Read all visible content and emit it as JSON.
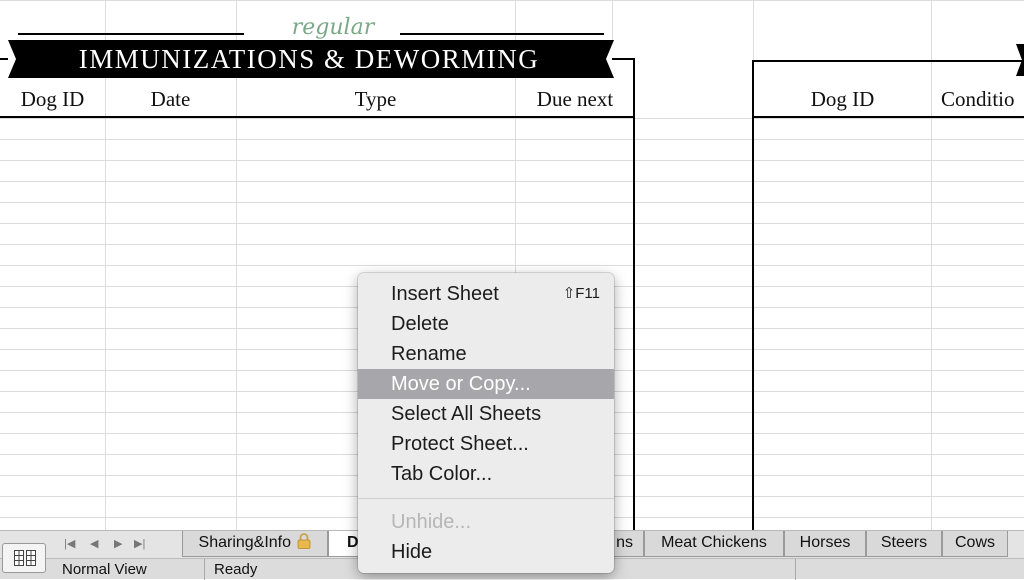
{
  "banner": {
    "script_text": "regular",
    "title": "IMMUNIZATIONS & DEWORMING"
  },
  "left_table": {
    "headers": [
      "Dog ID",
      "Date",
      "Type",
      "Due next"
    ]
  },
  "right_table": {
    "headers": [
      "Dog ID",
      "Conditio"
    ]
  },
  "context_menu": {
    "items": [
      {
        "label": "Insert Sheet",
        "shortcut": "⇧F11",
        "state": "normal"
      },
      {
        "label": "Delete",
        "state": "normal"
      },
      {
        "label": "Rename",
        "state": "normal"
      },
      {
        "label": "Move or Copy...",
        "state": "highlighted"
      },
      {
        "label": "Select All Sheets",
        "state": "normal"
      },
      {
        "label": "Protect Sheet...",
        "state": "normal"
      },
      {
        "label": "Tab Color...",
        "state": "normal"
      },
      {
        "label": "Unhide...",
        "state": "disabled"
      },
      {
        "label": "Hide",
        "state": "normal"
      }
    ]
  },
  "tabs": {
    "items": [
      {
        "label": "Sharing&Info",
        "locked": true
      },
      {
        "label": "D",
        "active": true
      },
      {
        "label": "ns"
      },
      {
        "label": "Meat Chickens"
      },
      {
        "label": "Horses"
      },
      {
        "label": "Steers"
      },
      {
        "label": "Cows"
      }
    ],
    "nav_glyphs": [
      "|◀",
      "◀",
      "▶",
      "▶|"
    ]
  },
  "status": {
    "view": "Normal View",
    "state": "Ready"
  },
  "icons": {
    "view_toggle": "grid-view-icon",
    "lock": "lock-icon"
  },
  "colors": {
    "highlight": "#a6a6ab",
    "script_green": "#7aa988"
  }
}
